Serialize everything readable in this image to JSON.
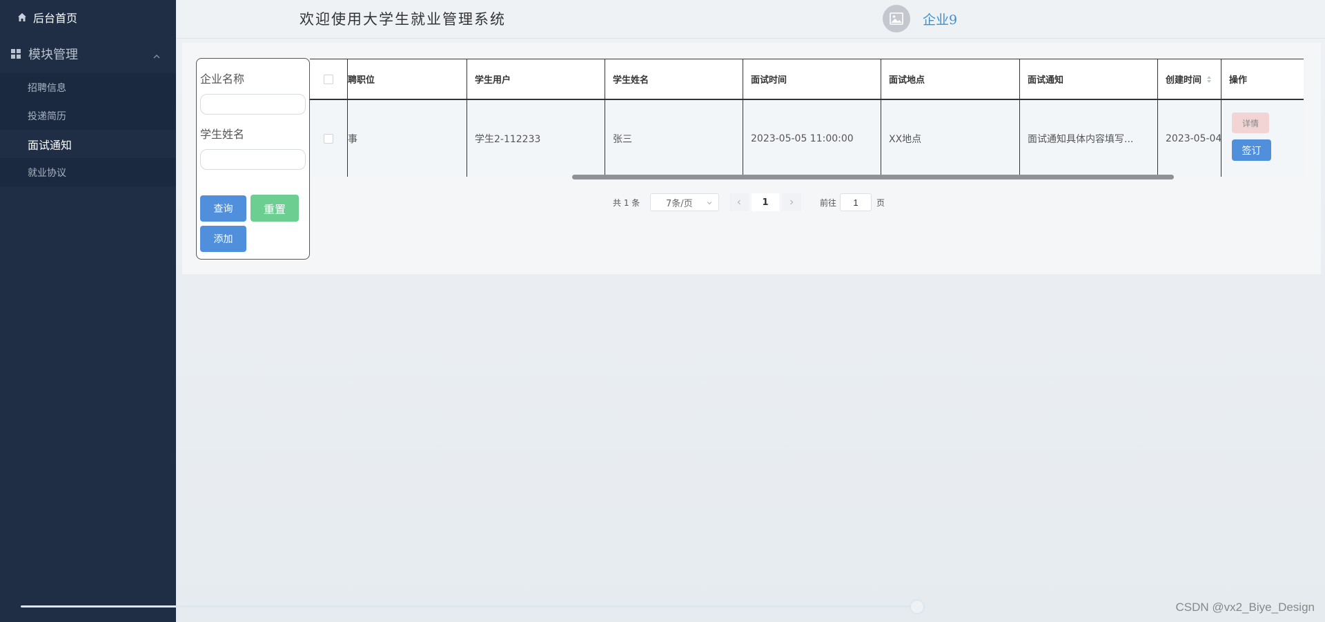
{
  "sidebar": {
    "home_label": "后台首页",
    "group_label": "模块管理",
    "items": [
      {
        "label": "招聘信息",
        "active": false
      },
      {
        "label": "投递简历",
        "active": false
      },
      {
        "label": "面试通知",
        "active": true
      },
      {
        "label": "就业协议",
        "active": false
      }
    ]
  },
  "header": {
    "welcome": "欢迎使用大学生就业管理系统",
    "company": "企业9"
  },
  "search": {
    "company_label": "企业名称",
    "company_value": "",
    "student_label": "学生姓名",
    "student_value": "",
    "query_button": "查询",
    "reset_button": "重置",
    "add_button": "添加"
  },
  "table": {
    "columns": [
      "聘职位",
      "学生用户",
      "学生姓名",
      "面试时间",
      "面试地点",
      "面试通知",
      "创建时间",
      "操作"
    ],
    "rows": [
      {
        "position": "事",
        "student_user": "学生2-112233",
        "student_name": "张三",
        "interview_time": "2023-05-05 11:00:00",
        "interview_place": "XX地点",
        "notice": "面试通知具体内容填写...",
        "created": "2023-05-04",
        "detail_button": "详情",
        "sign_button": "签订"
      }
    ]
  },
  "pagination": {
    "total_text": "共 1 条",
    "page_size": "7条/页",
    "current_page": "1",
    "goto_label": "前往",
    "goto_value": "1",
    "page_suffix": "页"
  },
  "watermark": "CSDN @vx2_Biye_Design",
  "colors": {
    "sidebar_bg": "#1f2d45",
    "primary_blue": "#4f8fdc",
    "reset_green": "#6ccf91",
    "detail_pink": "#f2d4d4",
    "company_link": "#3b8fd1"
  }
}
